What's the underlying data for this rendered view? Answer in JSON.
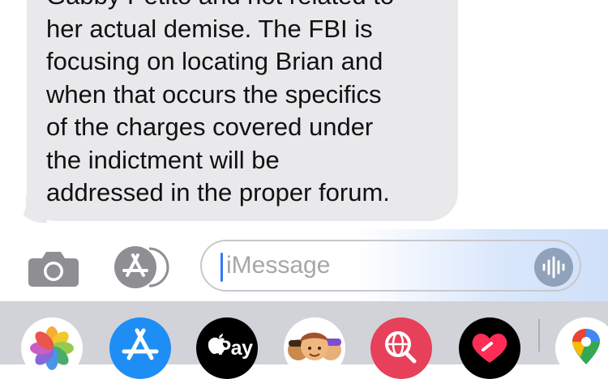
{
  "message": {
    "text": "Gabby Petito and not related to\nher actual demise.  The FBI is\nfocusing on locating Brian and\nwhen that occurs the specifics\nof the charges covered under\nthe indictment will be\naddressed in the proper forum."
  },
  "input": {
    "placeholder": "iMessage"
  },
  "dock": {
    "apple_pay_label": "Pay",
    "apps": [
      "photos",
      "app-store",
      "apple-pay",
      "memoji",
      "images-search",
      "digital-touch",
      "google-maps"
    ]
  },
  "colors": {
    "bubble": "#e9e9eb",
    "caret": "#3478f6",
    "dock_bg": "#d1d3d9",
    "voice_button": "#8fa2b9"
  }
}
